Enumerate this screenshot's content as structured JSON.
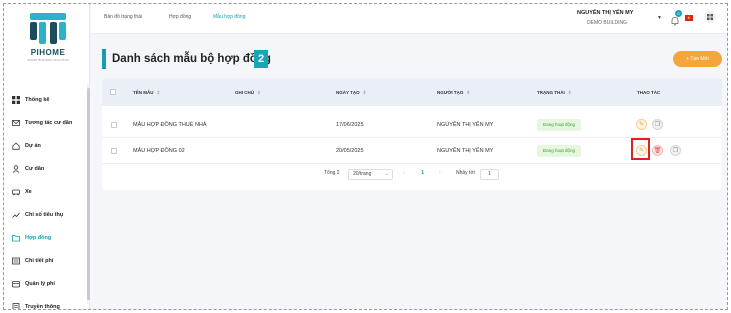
{
  "logo": {
    "name": "PIHOME",
    "tagline": "SMART BUILDING SOLUTION"
  },
  "sidebar": {
    "items": [
      {
        "label": "Thống kê",
        "icon": "dashboard-icon",
        "active": false
      },
      {
        "label": "Tương tác cư dân",
        "icon": "mail-icon",
        "active": false
      },
      {
        "label": "Dự án",
        "icon": "home-icon",
        "active": false
      },
      {
        "label": "Cư dân",
        "icon": "user-icon",
        "active": false
      },
      {
        "label": "Xe",
        "icon": "car-icon",
        "active": false
      },
      {
        "label": "Chỉ số tiêu thụ",
        "icon": "meter-icon",
        "active": false
      },
      {
        "label": "Hợp đồng",
        "icon": "folder-icon",
        "active": true
      },
      {
        "label": "Chi tiết phí",
        "icon": "fee-detail-icon",
        "active": false
      },
      {
        "label": "Quản lý phí",
        "icon": "wallet-icon",
        "active": false
      },
      {
        "label": "Truyền thông",
        "icon": "news-icon",
        "active": false
      }
    ]
  },
  "header": {
    "tabs": [
      {
        "label": "Bản đồ trạng thái",
        "active": false
      },
      {
        "label": "Hợp đồng",
        "active": false
      },
      {
        "label": "Mẫu hợp đồng",
        "active": true
      }
    ],
    "user_name": "NGUYỄN THỊ YẾN MY",
    "building": "DEMO BUILDING",
    "notification_count": "0",
    "flag_star": "★"
  },
  "main": {
    "title": "Danh sách mẫu bộ hợp đồng",
    "count": "2",
    "create_label": "+ Tạo Mới"
  },
  "table": {
    "columns": [
      "TÊN MẪU",
      "GHI CHÚ",
      "NGÀY TẠO",
      "NGƯỜI TẠO",
      "TRẠNG THÁI",
      "THAO TÁC"
    ],
    "sort_symbol": "⇕",
    "rows": [
      {
        "name": "MẪU HỢP ĐỒNG THUÊ NHÀ",
        "note": "",
        "created": "17/06/2025",
        "creator": "NGUYỄN THỊ YẾN MY",
        "status": "Đang hoạt động"
      },
      {
        "name": "MẪU HỢP ĐỒNG 02",
        "note": "",
        "created": "20/05/2025",
        "creator": "NGUYỄN THỊ YẾN MY",
        "status": "Đang hoạt động"
      }
    ]
  },
  "pagination": {
    "total": "Tổng 2",
    "page_size": "20/trang",
    "prev": "‹",
    "current": "1",
    "next": "›",
    "jump_label": "Nhảy tới",
    "jump_value": "1"
  },
  "colors": {
    "accent": "#1a9cb0",
    "create": "#f4a63a",
    "status_bg": "#e6f7df",
    "highlight": "#e02020"
  }
}
